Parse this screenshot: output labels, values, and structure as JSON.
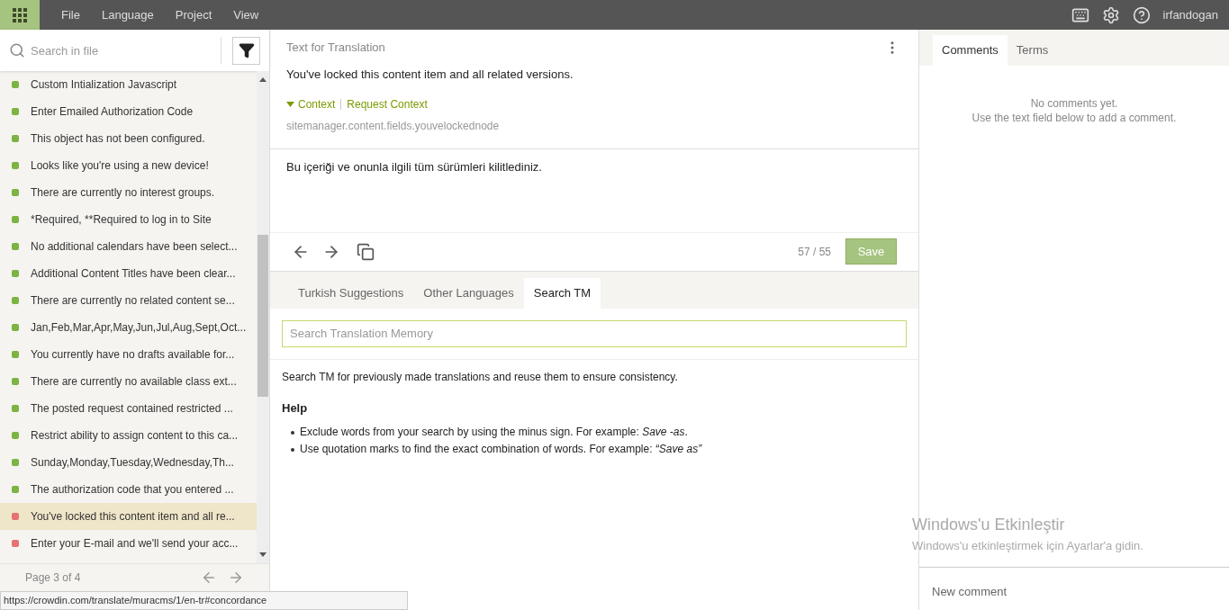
{
  "menu": [
    "File",
    "Language",
    "Project",
    "View"
  ],
  "user": "irfandogan",
  "sidebar": {
    "search": {
      "placeholder": "Search in file"
    },
    "items": [
      {
        "text": "Custom Intialization Javascript",
        "color": "#7cb342",
        "selected": false
      },
      {
        "text": "Enter Emailed Authorization Code",
        "color": "#7cb342",
        "selected": false
      },
      {
        "text": "This object has not been configured.",
        "color": "#7cb342",
        "selected": false
      },
      {
        "text": "Looks like you're using a new device!",
        "color": "#7cb342",
        "selected": false
      },
      {
        "text": "There are currently no interest groups.",
        "color": "#7cb342",
        "selected": false
      },
      {
        "text": "*Required, **Required to log in to Site",
        "color": "#7cb342",
        "selected": false
      },
      {
        "text": "No additional calendars have been select...",
        "color": "#7cb342",
        "selected": false
      },
      {
        "text": "Additional Content Titles have been clear...",
        "color": "#7cb342",
        "selected": false
      },
      {
        "text": "There are currently no related content se...",
        "color": "#7cb342",
        "selected": false
      },
      {
        "text": "Jan,Feb,Mar,Apr,May,Jun,Jul,Aug,Sept,Oct...",
        "color": "#7cb342",
        "selected": false
      },
      {
        "text": "You currently have no drafts available for...",
        "color": "#7cb342",
        "selected": false
      },
      {
        "text": "There are currently no available class ext...",
        "color": "#7cb342",
        "selected": false
      },
      {
        "text": "The posted request contained restricted ...",
        "color": "#7cb342",
        "selected": false
      },
      {
        "text": "Restrict ability to assign content to this ca...",
        "color": "#7cb342",
        "selected": false
      },
      {
        "text": "Sunday,Monday,Tuesday,Wednesday,Th...",
        "color": "#7cb342",
        "selected": false
      },
      {
        "text": "The authorization code that you entered ...",
        "color": "#7cb342",
        "selected": false
      },
      {
        "text": "You've locked this content item and all re...",
        "color": "#e57373",
        "selected": true
      },
      {
        "text": "Enter your E-mail and we'll send your acc...",
        "color": "#e57373",
        "selected": false
      }
    ],
    "pager": "Page 3 of 4"
  },
  "editor": {
    "title": "Text for Translation",
    "source": "You've locked this content item and all related versions.",
    "context_link": "Context",
    "request_context": "Request Context",
    "key": "sitemanager.content.fields.youvelockednode",
    "translation": "Bu içeriği ve onunla ilgili tüm sürümleri kilitlediniz.",
    "counter": "57 / 55",
    "save": "Save"
  },
  "suggestions": {
    "tabs": [
      {
        "label": "Turkish Suggestions",
        "selected": false
      },
      {
        "label": "Other Languages",
        "selected": false
      },
      {
        "label": "Search TM",
        "selected": true
      }
    ],
    "search": {
      "placeholder": "Search Translation Memory"
    },
    "intro": "Search TM for previously made translations and reuse them to ensure consistency.",
    "help_title": "Help",
    "help": [
      "Exclude words from your search by using the minus sign. For example: *Save -as*.",
      "Use quotation marks to find the exact combination of words. For example: *“Save as”*"
    ]
  },
  "comments": {
    "tabs": [
      {
        "label": "Comments",
        "selected": true
      },
      {
        "label": "Terms",
        "selected": false
      }
    ],
    "empty": [
      "No comments yet.",
      "Use the text field below to add a comment."
    ],
    "new": {
      "placeholder": "New comment"
    }
  },
  "os_notice": {
    "title": "Windows'u Etkinleştir",
    "text": "Windows'u etkinleştirmek için Ayarlar'a gidin."
  },
  "status_url": "https://crowdin.com/translate/muracms/1/en-tr#concordance"
}
